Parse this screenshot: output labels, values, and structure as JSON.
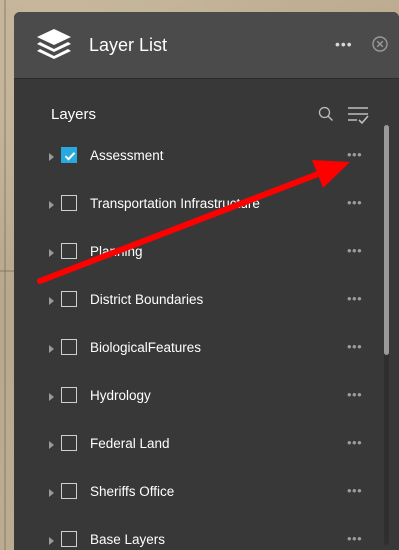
{
  "header": {
    "title": "Layer List",
    "more_label": "•••",
    "logo_icon": "layers-icon",
    "close_icon": "close-circle-icon"
  },
  "toolbar": {
    "label": "Layers",
    "search_icon": "search-icon",
    "options_icon": "filter-list-icon"
  },
  "layers": [
    {
      "name": "Assessment",
      "checked": true,
      "more": "•••"
    },
    {
      "name": "Transportation Infrastructure",
      "checked": false,
      "more": "•••"
    },
    {
      "name": "Planning",
      "checked": false,
      "more": "•••"
    },
    {
      "name": "District Boundaries",
      "checked": false,
      "more": "•••"
    },
    {
      "name": "BiologicalFeatures",
      "checked": false,
      "more": "•••"
    },
    {
      "name": "Hydrology",
      "checked": false,
      "more": "•••"
    },
    {
      "name": "Federal Land",
      "checked": false,
      "more": "•••"
    },
    {
      "name": "Sheriffs Office",
      "checked": false,
      "more": "•••"
    },
    {
      "name": "Base Layers",
      "checked": false,
      "more": "•••"
    }
  ],
  "colors": {
    "panel": "#383838",
    "header": "#4b4b4b",
    "accent": "#2aa9e0",
    "annotation_arrow": "#ff0000"
  },
  "annotation": {
    "arrow_icon": "red-arrow-annotation"
  }
}
